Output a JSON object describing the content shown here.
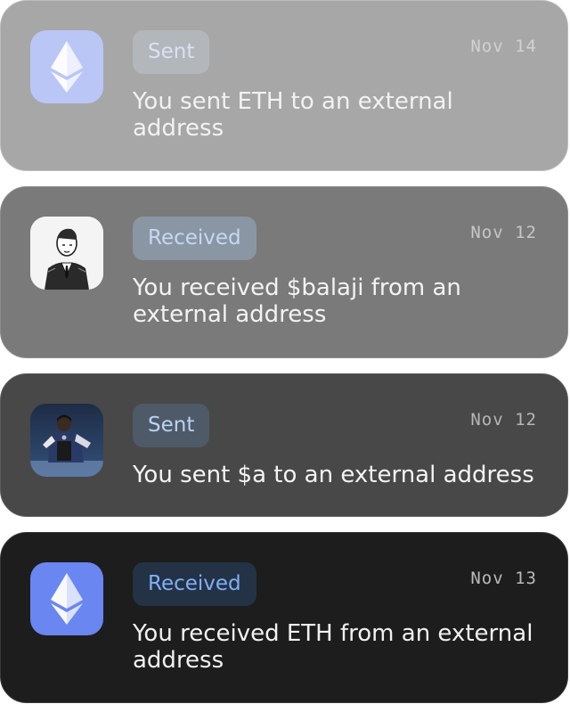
{
  "notifications": [
    {
      "badge": "Sent",
      "date": "Nov 14",
      "message": "You sent ETH to an external address",
      "avatar_icon": "ethereum-logo"
    },
    {
      "badge": "Received",
      "date": "Nov 12",
      "message": "You received $balaji from an external address",
      "avatar_icon": "person-sketch-portrait"
    },
    {
      "badge": "Sent",
      "date": "Nov 12",
      "message": "You sent $a to an external address",
      "avatar_icon": "person-photo-portrait"
    },
    {
      "badge": "Received",
      "date": "Nov 13",
      "message": "You received ETH from an external address",
      "avatar_icon": "ethereum-logo"
    }
  ],
  "colors": {
    "eth_tile_faded": "#bac6f6",
    "eth_tile": "#6a86f0",
    "received_badge_text": "#7fb0f4"
  }
}
